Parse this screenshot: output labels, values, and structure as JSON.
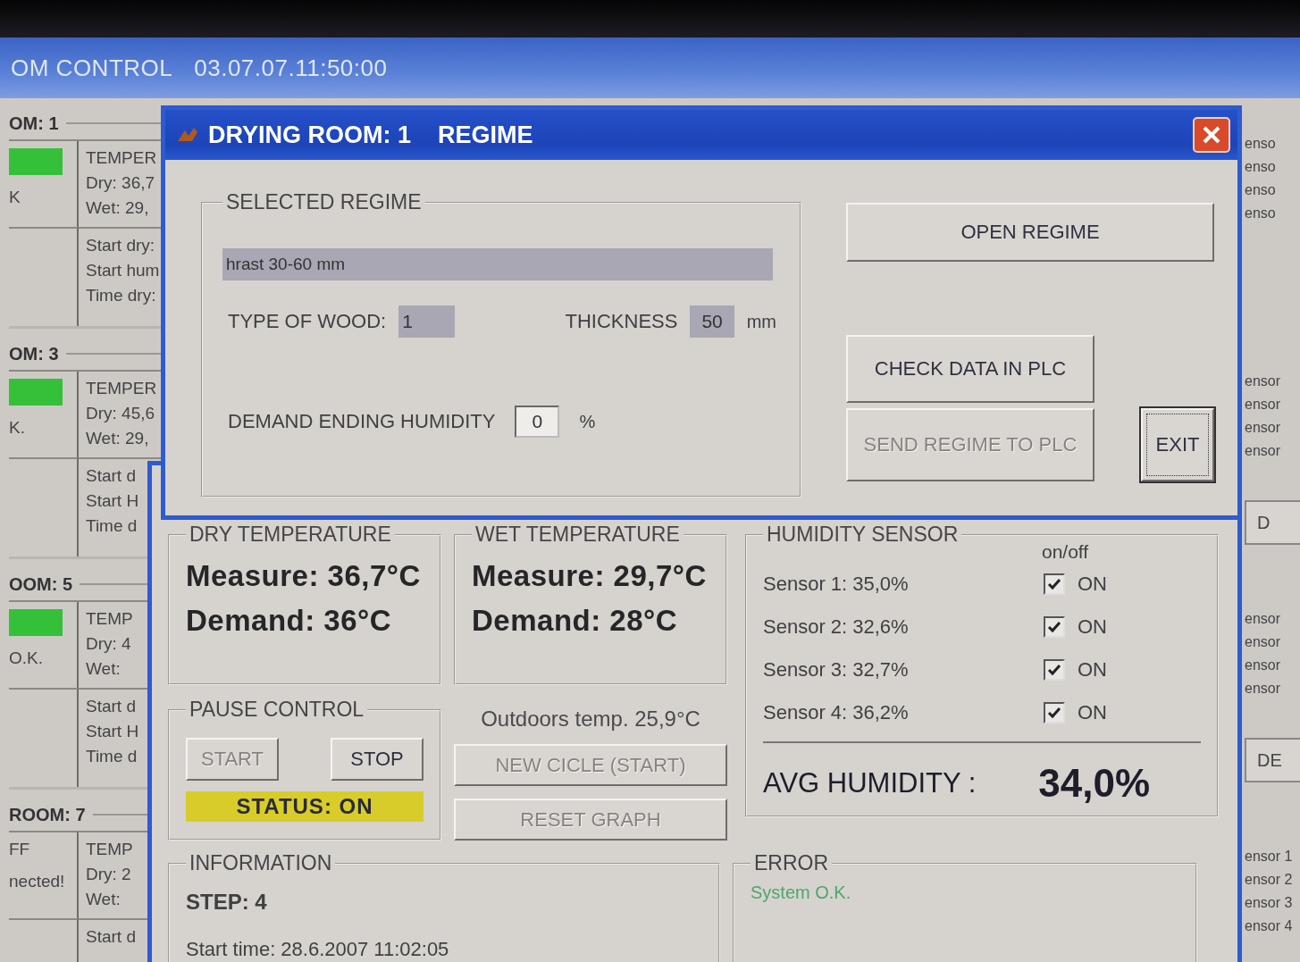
{
  "app": {
    "title": "OM CONTROL",
    "datetime": "03.07.07.11:50:00"
  },
  "rooms": [
    {
      "name": "OM: 1",
      "running": true,
      "status": "K",
      "temperature_label": "TEMPER",
      "dry": "Dry: 36,7",
      "wet": "Wet: 29,",
      "lines": [
        "Start dry:",
        "Start hum",
        "Time dry:"
      ]
    },
    {
      "name": "OM: 3",
      "running": true,
      "status": "K.",
      "temperature_label": "TEMPER",
      "dry": "Dry: 45,6",
      "wet": "Wet: 29,",
      "lines": [
        "Start d",
        "Start H",
        "Time d"
      ]
    },
    {
      "name": "OOM: 5",
      "running": true,
      "status": "O.K.",
      "temperature_label": "TEMP",
      "dry": "Dry: 4",
      "wet": "Wet:",
      "lines": [
        "Start d",
        "Start H",
        "Time d"
      ]
    },
    {
      "name": "ROOM: 7",
      "running": false,
      "status": "FF",
      "note": "nected!",
      "temperature_label": "TEMP",
      "dry": "Dry: 2",
      "wet": "Wet:",
      "lines": [
        "Start d"
      ]
    }
  ],
  "right_strip": [
    {
      "labels": [
        "enso",
        "enso",
        "enso",
        "enso"
      ]
    },
    {
      "labels": [
        "ensor",
        "ensor",
        "ensor",
        "ensor"
      ],
      "button": "D"
    },
    {
      "labels": [
        "ensor",
        "ensor",
        "ensor",
        "ensor"
      ],
      "button": "DE"
    },
    {
      "labels": [
        "ensor 1",
        "ensor 2",
        "ensor 3",
        "ensor 4"
      ]
    }
  ],
  "room_window": {
    "dry_temperature": {
      "title": "DRY TEMPERATURE",
      "measure": "Measure: 36,7°C",
      "demand": "Demand: 36°C"
    },
    "wet_temperature": {
      "title": "WET TEMPERATURE",
      "measure": "Measure: 29,7°C",
      "demand": "Demand: 28°C"
    },
    "pause_control": {
      "title": "PAUSE   CONTROL",
      "buttons": [
        {
          "label": "START",
          "disabled": true
        },
        {
          "label": "STOP",
          "disabled": false
        }
      ],
      "status": {
        "label": "STATUS: ON",
        "on": true
      }
    },
    "outdoors": "Outdoors temp.  25,9°C",
    "buttons": [
      {
        "label": "NEW CICLE (START)",
        "disabled": true
      },
      {
        "label": "RESET GRAPH",
        "disabled": true
      }
    ],
    "humidity_sensor": {
      "title": "HUMIDITY SENSOR",
      "column": "on/off",
      "sensors": [
        {
          "label": "Sensor 1: 35,0%",
          "checked": true,
          "state": "ON"
        },
        {
          "label": "Sensor 2: 32,6%",
          "checked": true,
          "state": "ON"
        },
        {
          "label": "Sensor 3: 32,7%",
          "checked": true,
          "state": "ON"
        },
        {
          "label": "Sensor 4: 36,2%",
          "checked": true,
          "state": "ON"
        }
      ],
      "avg_label": "AVG HUMIDITY :",
      "avg_value": "34,0%"
    },
    "information": {
      "title": "INFORMATION",
      "step": "STEP: 4",
      "start_time": "Start time: 28.6.2007 11:02:05"
    },
    "error": {
      "title": "ERROR",
      "message": "System O.K."
    }
  },
  "regime_dialog": {
    "title": "DRYING ROOM: 1",
    "subtitle": "REGIME",
    "selected_regime": {
      "title": "SELECTED REGIME",
      "regime": "hrast 30-60 mm",
      "wood_label": "TYPE OF WOOD:",
      "wood": "1",
      "thickness_label": "THICKNESS",
      "thickness": "50",
      "thickness_unit": "mm",
      "humidity_label": "DEMAND ENDING HUMIDITY",
      "humidity": "0",
      "humidity_unit": "%"
    },
    "buttons": [
      {
        "label": "OPEN REGIME",
        "disabled": false,
        "focused": false
      },
      {
        "label": "CHECK DATA IN PLC",
        "disabled": false,
        "focused": false
      },
      {
        "label": "SEND REGIME TO PLC",
        "disabled": true,
        "focused": false
      },
      {
        "label": "EXIT",
        "disabled": false,
        "focused": true
      }
    ]
  }
}
